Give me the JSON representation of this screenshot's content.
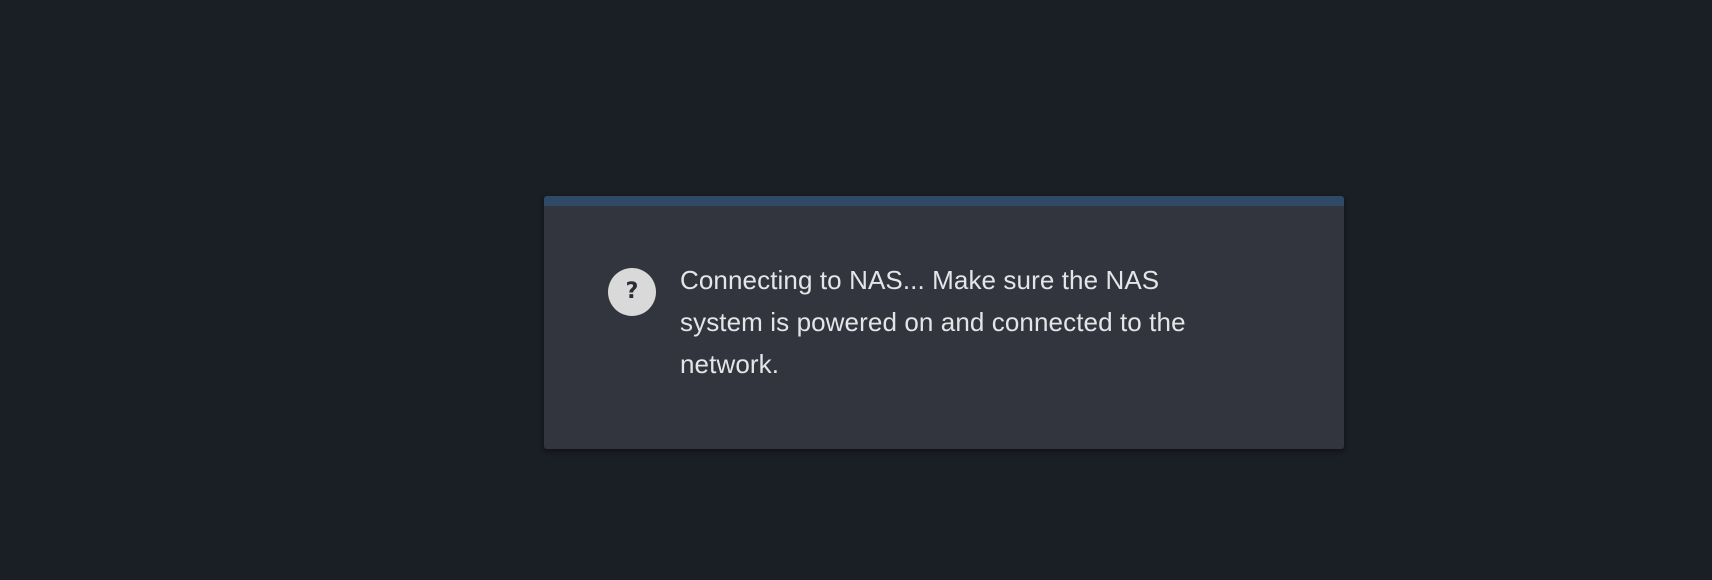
{
  "dialog": {
    "icon": "question-icon",
    "icon_glyph": "?",
    "message": "Connecting to NAS... Make sure the NAS system is powered on and connected to the network."
  },
  "colors": {
    "background": "#1a1e25",
    "dialog_background": "#32353d",
    "accent_bar": "#2e4a66",
    "icon_background": "#d9d9d9",
    "text": "#e4e5e8"
  }
}
